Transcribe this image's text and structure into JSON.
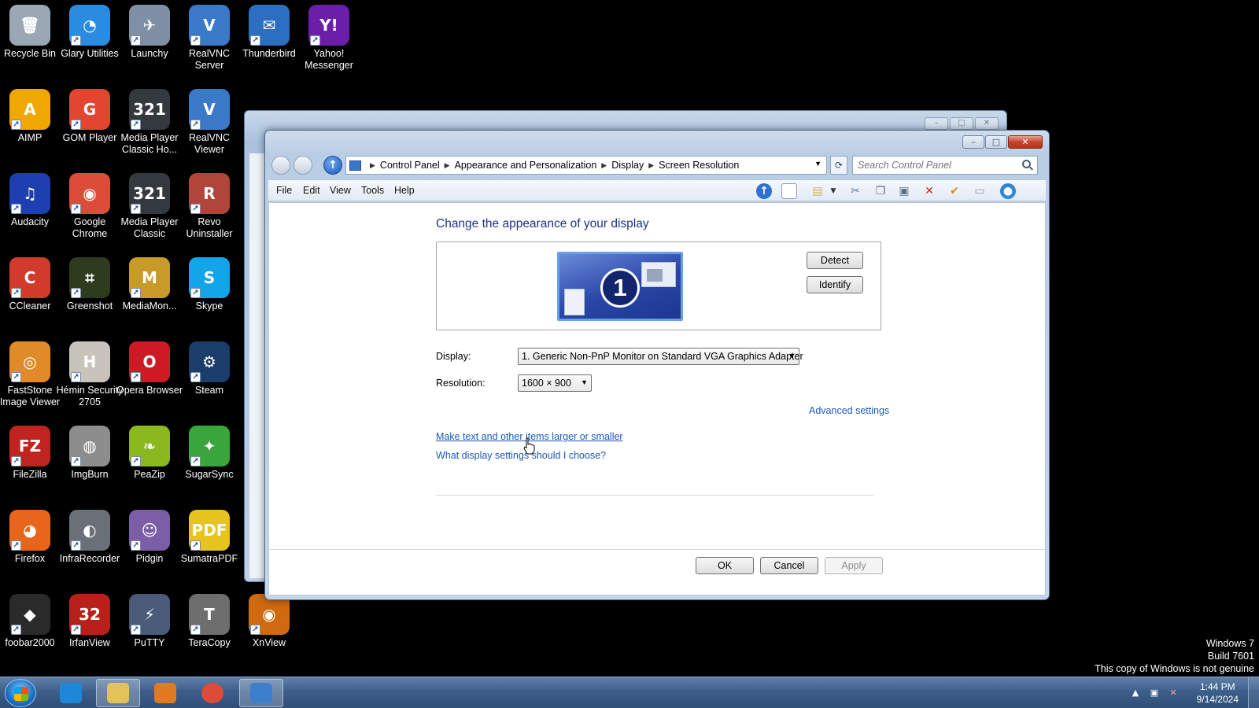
{
  "desktop": {
    "icons": [
      {
        "label": "Recycle Bin",
        "icon": "recycle-bin-icon",
        "color": "#9aa7b5",
        "glyph": "🗑"
      },
      {
        "label": "Glary Utilities",
        "icon": "glary-utilities-icon",
        "color": "#2a8ce0",
        "glyph": "◔"
      },
      {
        "label": "Launchy",
        "icon": "launchy-icon",
        "color": "#7f8fa4",
        "glyph": "✈"
      },
      {
        "label": "RealVNC Server",
        "icon": "realvnc-server-icon",
        "color": "#3a78c8",
        "glyph": "V"
      },
      {
        "label": "Thunderbird",
        "icon": "thunderbird-icon",
        "color": "#2c6fc0",
        "glyph": "✉"
      },
      {
        "label": "Yahoo! Messenger",
        "icon": "yahoo-messenger-icon",
        "color": "#6b1fa8",
        "glyph": "Y!"
      },
      {
        "label": "AIMP",
        "icon": "aimp-icon",
        "color": "#f0a800",
        "glyph": "A"
      },
      {
        "label": "GOM Player",
        "icon": "gom-player-icon",
        "color": "#e24530",
        "glyph": "G"
      },
      {
        "label": "Media Player Classic Ho...",
        "icon": "media-player-classic-home-icon",
        "color": "#34383f",
        "glyph": "321"
      },
      {
        "label": "RealVNC Viewer",
        "icon": "realvnc-viewer-icon",
        "color": "#3a78c8",
        "glyph": "V"
      },
      {
        "label": "Audacity",
        "icon": "audacity-icon",
        "color": "#1d3fb0",
        "glyph": "♫"
      },
      {
        "label": "Google Chrome",
        "icon": "google-chrome-icon",
        "color": "#dd4b39",
        "glyph": "◉"
      },
      {
        "label": "Media Player Classic",
        "icon": "media-player-classic-icon",
        "color": "#34383f",
        "glyph": "321"
      },
      {
        "label": "Revo Uninstaller",
        "icon": "revo-uninstaller-icon",
        "color": "#b0463a",
        "glyph": "R"
      },
      {
        "label": "CCleaner",
        "icon": "ccleaner-icon",
        "color": "#d23b2b",
        "glyph": "C"
      },
      {
        "label": "Greenshot",
        "icon": "greenshot-icon",
        "color": "#2e3b1f",
        "glyph": "⌗"
      },
      {
        "label": "MediaMon...",
        "icon": "mediamonkey-icon",
        "color": "#c89a28",
        "glyph": "M"
      },
      {
        "label": "Skype",
        "icon": "skype-icon",
        "color": "#12a5e8",
        "glyph": "S"
      },
      {
        "label": "FastStone Image Viewer",
        "icon": "faststone-icon",
        "color": "#e08a2a",
        "glyph": "◎"
      },
      {
        "label": "Hémin Security 2705",
        "icon": "hemin-security-icon",
        "color": "#c8c4bc",
        "glyph": "H"
      },
      {
        "label": "Opera Browser",
        "icon": "opera-icon",
        "color": "#cc1b24",
        "glyph": "O"
      },
      {
        "label": "Steam",
        "icon": "steam-icon",
        "color": "#1b3d6b",
        "glyph": "⚙"
      },
      {
        "label": "FileZilla",
        "icon": "filezilla-icon",
        "color": "#c0241f",
        "glyph": "FZ"
      },
      {
        "label": "ImgBurn",
        "icon": "imgburn-icon",
        "color": "#8d8d8d",
        "glyph": "◍"
      },
      {
        "label": "PeaZip",
        "icon": "peazip-icon",
        "color": "#8ab81e",
        "glyph": "❧"
      },
      {
        "label": "SugarSync",
        "icon": "sugarsync-icon",
        "color": "#3aa53a",
        "glyph": "✦"
      },
      {
        "label": "Firefox",
        "icon": "firefox-icon",
        "color": "#e8661b",
        "glyph": "◕"
      },
      {
        "label": "InfraRecorder",
        "icon": "infrarecorder-icon",
        "color": "#6b7078",
        "glyph": "◐"
      },
      {
        "label": "Pidgin",
        "icon": "pidgin-icon",
        "color": "#7b5ea6",
        "glyph": "☺"
      },
      {
        "label": "SumatraPDF",
        "icon": "sumatrapdf-icon",
        "color": "#e6c31d",
        "glyph": "PDF"
      },
      {
        "label": "foobar2000",
        "icon": "foobar2000-icon",
        "color": "#2a2a2a",
        "glyph": "◆"
      },
      {
        "label": "IrfanView",
        "icon": "irfanview-icon",
        "color": "#b8211a",
        "glyph": "32"
      },
      {
        "label": "PuTTY",
        "icon": "putty-icon",
        "color": "#4a5a78",
        "glyph": "⚡"
      },
      {
        "label": "TeraCopy",
        "icon": "teracopy-icon",
        "color": "#6e6e6e",
        "glyph": "T"
      },
      {
        "label": "XnView",
        "icon": "xnview-icon",
        "color": "#d06a10",
        "glyph": "◉"
      }
    ]
  },
  "watermark": {
    "line1": "Windows 7",
    "line2": "Build 7601",
    "line3": "This copy of Windows is not genuine"
  },
  "window": {
    "breadcrumbs": [
      "Control Panel",
      "Appearance and Personalization",
      "Display",
      "Screen Resolution"
    ],
    "search_placeholder": "Search Control Panel",
    "menu": [
      "File",
      "Edit",
      "View",
      "Tools",
      "Help"
    ],
    "heading": "Change the appearance of your display",
    "monitor_number": "1",
    "detect_label": "Detect",
    "identify_label": "Identify",
    "display_label": "Display:",
    "display_value": "1. Generic Non-PnP Monitor on Standard VGA Graphics Adapter",
    "resolution_label": "Resolution:",
    "resolution_value": "1600 × 900",
    "advanced_settings": "Advanced settings",
    "link_text_size": "Make text and other items larger or smaller",
    "link_which_settings": "What display settings should I choose?",
    "ok_label": "OK",
    "cancel_label": "Cancel",
    "apply_label": "Apply"
  },
  "taskbar": {
    "time": "1:44 PM",
    "date": "9/14/2024",
    "pinned": [
      {
        "icon": "internet-explorer-icon",
        "color": "#1e88d8"
      },
      {
        "icon": "windows-explorer-icon",
        "color": "#e3c25a"
      },
      {
        "icon": "media-player-icon",
        "color": "#e07a22"
      },
      {
        "icon": "google-chrome-icon",
        "color": "#dd4b39"
      },
      {
        "icon": "control-panel-icon",
        "color": "#3e7fcc"
      }
    ]
  },
  "colors": {
    "heading": "#1e3287",
    "link": "#1e57b8",
    "close_button": "#c4452d"
  }
}
